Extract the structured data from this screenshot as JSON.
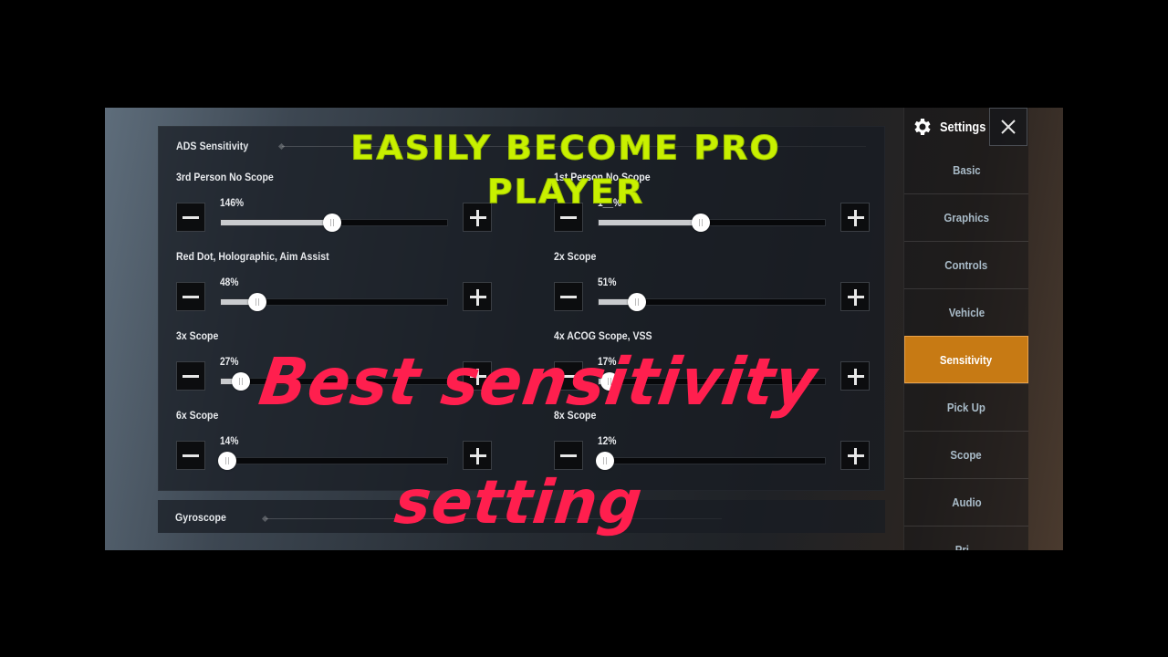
{
  "sidebar": {
    "title": "Settings",
    "icon": "gear-icon",
    "close_icon": "close-icon",
    "items": [
      {
        "label": "Basic",
        "active": false
      },
      {
        "label": "Graphics",
        "active": false
      },
      {
        "label": "Controls",
        "active": false
      },
      {
        "label": "Vehicle",
        "active": false
      },
      {
        "label": "Sensitivity",
        "active": true
      },
      {
        "label": "Pick Up",
        "active": false
      },
      {
        "label": "Scope",
        "active": false
      },
      {
        "label": "Audio",
        "active": false
      },
      {
        "label": "Pri...",
        "active": false
      }
    ]
  },
  "ads_section": {
    "title": "ADS Sensitivity",
    "settings": [
      {
        "label": "3rd Person No Scope",
        "value_text": "146%",
        "fraction": 0.49
      },
      {
        "label": "1st Person No Scope",
        "value_text": "1__%",
        "fraction": 0.45
      },
      {
        "label": "Red Dot, Holographic, Aim Assist",
        "value_text": "48%",
        "fraction": 0.16
      },
      {
        "label": "2x Scope",
        "value_text": "51%",
        "fraction": 0.17
      },
      {
        "label": "3x Scope",
        "value_text": "27%",
        "fraction": 0.09
      },
      {
        "label": "4x ACOG Scope, VSS",
        "value_text": "17%",
        "fraction": 0.05
      },
      {
        "label": "6x Scope",
        "value_text": "14%",
        "fraction": 0.03
      },
      {
        "label": "8x Scope",
        "value_text": "12%",
        "fraction": 0.03
      }
    ],
    "minus_icon": "minus-icon",
    "plus_icon": "plus-icon"
  },
  "gyro_section": {
    "title": "Gyroscope"
  },
  "overlay": {
    "headline_line1": "EASILY BECOME PRO",
    "headline_line2": "PLAYER",
    "headline_color": "#c8f000",
    "caption_line1": "Best sensitivity",
    "caption_line2": "setting",
    "caption_color": "#ff1f4e"
  },
  "colors": {
    "accent_active_tab": "#c77a14",
    "nav_text": "#a9bbc8"
  }
}
